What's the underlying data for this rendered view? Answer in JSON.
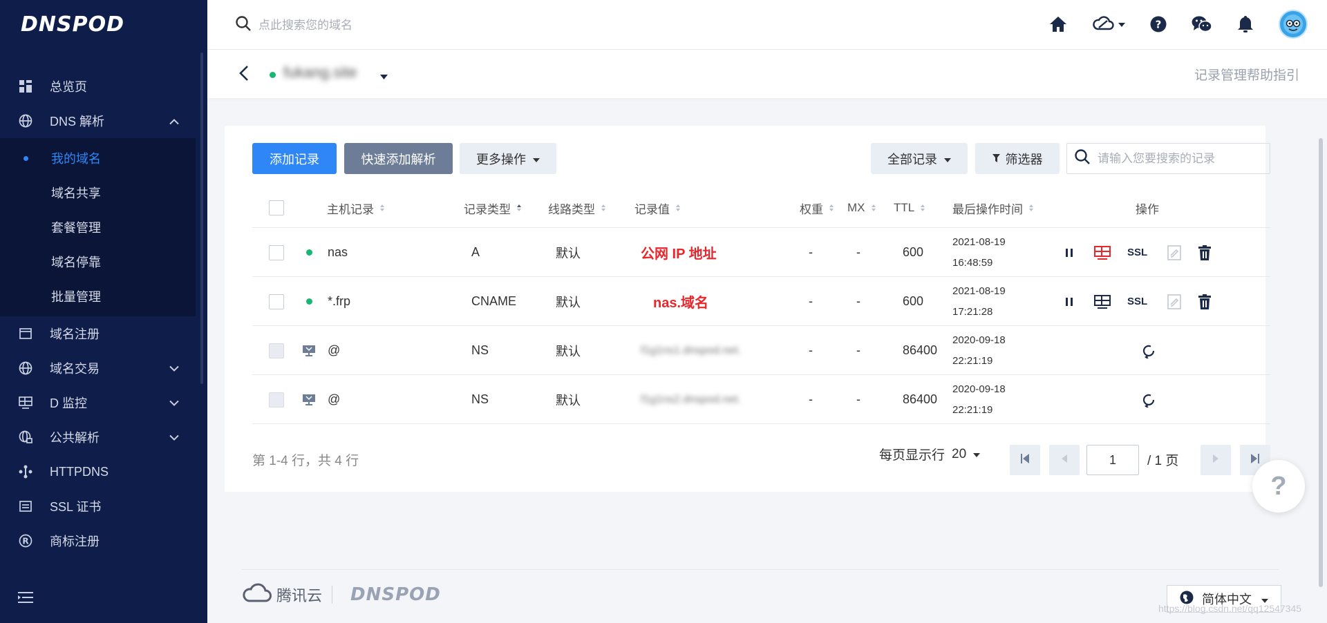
{
  "brand": {
    "logo": "DNSPOD"
  },
  "sidebar": {
    "items": [
      {
        "label": "总览页",
        "icon": "dashboard-icon"
      },
      {
        "label": "DNS 解析",
        "icon": "globe-icon",
        "expanded": true
      },
      {
        "label": "域名注册",
        "icon": "calendar-icon"
      },
      {
        "label": "域名交易",
        "icon": "globe-icon"
      },
      {
        "label": "D 监控",
        "icon": "monitor-icon"
      },
      {
        "label": "公共解析",
        "icon": "globe-lock-icon"
      },
      {
        "label": "HTTPDNS",
        "icon": "httpdns-icon"
      },
      {
        "label": "SSL 证书",
        "icon": "certificate-icon"
      },
      {
        "label": "商标注册",
        "icon": "registered-icon"
      }
    ],
    "dns_sub": [
      {
        "label": "我的域名",
        "active": true
      },
      {
        "label": "域名共享"
      },
      {
        "label": "套餐管理"
      },
      {
        "label": "域名停靠"
      },
      {
        "label": "批量管理"
      }
    ]
  },
  "topbar": {
    "search_placeholder": "点此搜索您的域名"
  },
  "subheader": {
    "domain": "fukang.site",
    "help_link": "记录管理帮助指引"
  },
  "toolbar": {
    "add_record": "添加记录",
    "quick_add": "快速添加解析",
    "more_actions": "更多操作",
    "all_records": "全部记录",
    "filter": "筛选器",
    "search_placeholder": "请输入您要搜索的记录"
  },
  "table": {
    "headers": {
      "host": "主机记录",
      "type": "记录类型",
      "line": "线路类型",
      "value": "记录值",
      "weight": "权重",
      "mx": "MX",
      "ttl": "TTL",
      "time": "最后操作时间",
      "ops": "操作"
    },
    "rows": [
      {
        "host": "nas",
        "type": "A",
        "line": "默认",
        "value": "公网 IP 地址",
        "weight": "-",
        "mx": "-",
        "ttl": "600",
        "date": "2021-08-19",
        "clock": "16:48:59"
      },
      {
        "host": "*.frp",
        "type": "CNAME",
        "line": "默认",
        "value": "nas.域名",
        "weight": "-",
        "mx": "-",
        "ttl": "600",
        "date": "2021-08-19",
        "clock": "17:21:28"
      },
      {
        "host": "@",
        "type": "NS",
        "line": "默认",
        "value": "f1g1ns1.dnspod.net.",
        "weight": "-",
        "mx": "-",
        "ttl": "86400",
        "date": "2020-09-18",
        "clock": "22:21:19"
      },
      {
        "host": "@",
        "type": "NS",
        "line": "默认",
        "value": "f1g1ns2.dnspod.net.",
        "weight": "-",
        "mx": "-",
        "ttl": "86400",
        "date": "2020-09-18",
        "clock": "22:21:19"
      }
    ],
    "ssl_label": "SSL"
  },
  "pagination": {
    "summary": "第 1-4 行，共 4 行",
    "per_page_label": "每页显示行",
    "per_page": "20",
    "current_page": "1",
    "total_pages": "/ 1 页"
  },
  "footer": {
    "tencent": "腾讯云",
    "dnspod": "DNSPOD",
    "language": "简体中文"
  },
  "watermark": "https://blog.csdn.net/qq12547345",
  "colors": {
    "sidebar_bg": "#0f1d4a",
    "primary": "#2f86f6",
    "danger": "#e8262c",
    "success": "#16b871"
  }
}
